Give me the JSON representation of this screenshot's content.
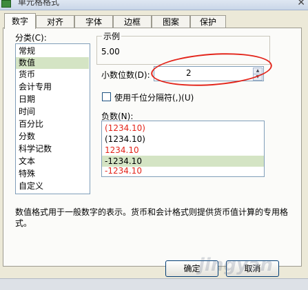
{
  "window": {
    "title": "单元格格式"
  },
  "tabs": [
    {
      "label": "数字",
      "active": true
    },
    {
      "label": "对齐",
      "active": false
    },
    {
      "label": "字体",
      "active": false
    },
    {
      "label": "边框",
      "active": false
    },
    {
      "label": "图案",
      "active": false
    },
    {
      "label": "保护",
      "active": false
    }
  ],
  "category": {
    "label": "分类(C):",
    "items": [
      "常规",
      "数值",
      "货币",
      "会计专用",
      "日期",
      "时间",
      "百分比",
      "分数",
      "科学记数",
      "文本",
      "特殊",
      "自定义"
    ],
    "selected": "数值"
  },
  "sample": {
    "label": "示例",
    "value": "5.00"
  },
  "decimals": {
    "label": "小数位数(D):",
    "value": "2"
  },
  "thousands": {
    "label": "使用千位分隔符(,)(U)",
    "checked": false
  },
  "negative": {
    "label": "负数(N):",
    "items": [
      {
        "text": "(1234.10)",
        "color": "#e3241a"
      },
      {
        "text": "(1234.10)",
        "color": "#000000"
      },
      {
        "text": "1234.10",
        "color": "#e3241a"
      },
      {
        "text": "-1234.10",
        "color": "#000000",
        "selected": true
      },
      {
        "text": "-1234.10",
        "color": "#e3241a"
      }
    ]
  },
  "description": "数值格式用于一般数字的表示。货币和会计格式则提供货币值计算的专用格式。",
  "buttons": {
    "ok": "确定",
    "cancel": "取消"
  },
  "watermark": "jingyan",
  "colors": {
    "selection": "#d4e4c4",
    "annotation": "#e3241a",
    "panel": "#fbfbf9"
  }
}
